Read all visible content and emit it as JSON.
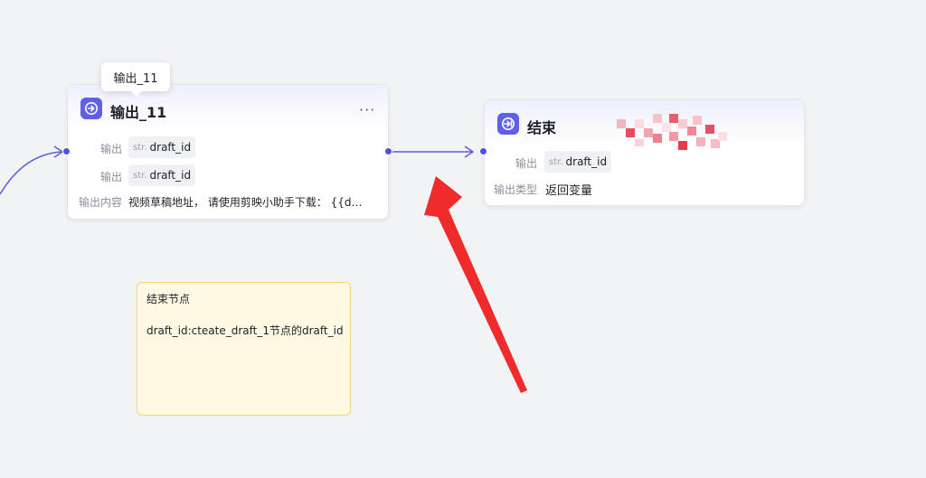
{
  "tooltip": {
    "text": "输出_11"
  },
  "output_node": {
    "title": "输出_11",
    "more_label": "···",
    "rows": [
      {
        "label": "输出",
        "type": "str.",
        "value": "draft_id"
      },
      {
        "label": "输出",
        "type": "str.",
        "value": "draft_id"
      }
    ],
    "content_label": "输出内容",
    "content_value": "视频草稿地址， 请使用剪映小助手下载： {{dra···"
  },
  "end_node": {
    "title": "结束",
    "row": {
      "label": "输出",
      "type": "str.",
      "value": "draft_id"
    },
    "type_label": "输出类型",
    "type_value": "返回变量"
  },
  "note": {
    "title": "结束节点",
    "body": "draft_id:cteate_draft_1节点的draft_id"
  },
  "colors": {
    "accent": "#5e60e6",
    "edge": "#5b5fd6",
    "arrow": "#f02b2b",
    "note_bg": "#fef9e3",
    "note_border": "#f2d577"
  },
  "icons": [
    "output-node-icon",
    "end-node-icon",
    "more-icon",
    "red-arrow-annotation"
  ]
}
